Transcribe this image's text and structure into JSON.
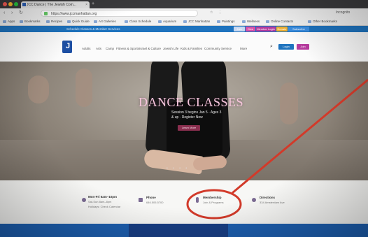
{
  "browser": {
    "tab_title": "JCC Dance | The Jewish Com...",
    "tab_close": "×",
    "new_tab": "+",
    "address": "https://www.jccmanhattan.org",
    "nav": {
      "back": "‹",
      "forward": "›",
      "reload": "↻"
    },
    "toolbar_right": [
      "☆",
      "⋮",
      "Incognito"
    ],
    "bookmarks": [
      "Apps",
      "Bookmarks",
      "Recipes",
      "Quick Guide",
      "Art Galleries",
      "Class Schedule",
      "Aquarium",
      "JCC Manhattan",
      "Paintings",
      "Wellness",
      "Online Contacts",
      "Other Bookmarks"
    ]
  },
  "site": {
    "utility": {
      "text": "Schedule Classes & Member Services",
      "buttons": [
        {
          "label": "Join",
          "color": "#c9d8f0"
        },
        {
          "label": "Give",
          "color": "#d94fa8"
        },
        {
          "label": "Member Login",
          "color": "#b63a9e"
        },
        {
          "label": "Donate",
          "color": "#f0b030"
        },
        {
          "label": "Subscribe",
          "color": "#3c8ee0"
        }
      ]
    },
    "logo_letter": "J",
    "nav": [
      "Adults",
      "Arts",
      "Camp",
      "Fitness & Sports",
      "Israel & Culture",
      "Jewish Life",
      "Kids & Families",
      "Community Service",
      "More"
    ],
    "search_icon": "⌕",
    "nav_buttons": [
      {
        "label": "Login",
        "color": "#1e73be"
      },
      {
        "label": "Join",
        "color": "#b63a9e"
      }
    ],
    "hero": {
      "title": "DANCE CLASSES",
      "subtitle_line1": "Session 3 begins Jan 5 · Ages 3",
      "subtitle_line2": "& up · Register Now",
      "button": "Learn More",
      "dots": "• • • •"
    },
    "info": [
      {
        "title": "Mon-Fri 6am–10pm",
        "sub1": "Sat-Sun 8am–8pm",
        "sub2": "Holidays: Check Calendar"
      },
      {
        "title": "Phone",
        "sub1": "646.505.5700"
      },
      {
        "title": "Membership",
        "sub1": "Join & Programs"
      },
      {
        "title": "Directions",
        "sub1": "334 Amsterdam Ave"
      }
    ]
  },
  "annotation": {
    "color": "#d23a2a"
  }
}
